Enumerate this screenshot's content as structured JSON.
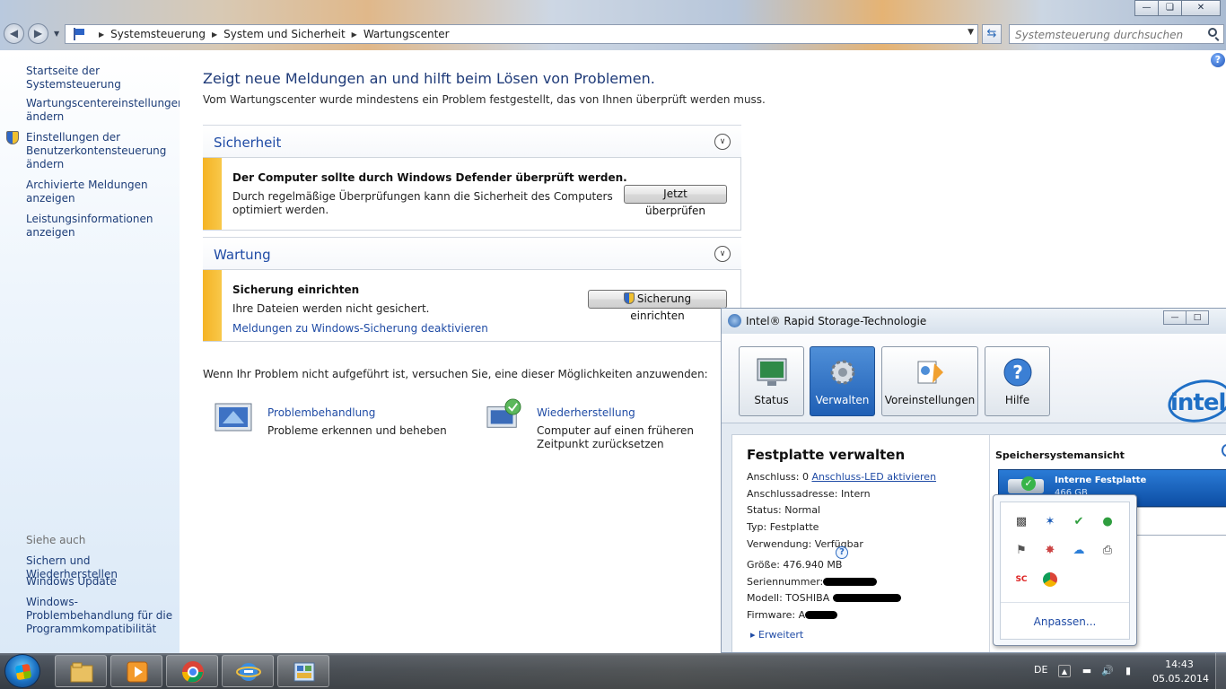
{
  "explorer": {
    "breadcrumb": [
      "Systemsteuerung",
      "System und Sicherheit",
      "Wartungscenter"
    ],
    "search_placeholder": "Systemsteuerung durchsuchen"
  },
  "sidebar": {
    "links": [
      "Startseite der Systemsteuerung",
      "Wartungscentereinstellungen ändern",
      "Einstellungen der Benutzerkontensteuerung ändern",
      "Archivierte Meldungen anzeigen",
      "Leistungsinformationen anzeigen"
    ],
    "see_also_label": "Siehe auch",
    "see_also": [
      "Sichern und Wiederherstellen",
      "Windows Update",
      "Windows-Problembehandlung für die Programmkompatibilität"
    ]
  },
  "main": {
    "title": "Zeigt neue Meldungen an und hilft beim Lösen von Problemen.",
    "subtitle": "Vom Wartungscenter wurde mindestens ein Problem festgestellt, das von Ihnen überprüft werden muss.",
    "security": {
      "heading": "Sicherheit",
      "msg_title": "Der Computer sollte durch Windows Defender überprüft werden.",
      "msg_text": "Durch regelmäßige Überprüfungen kann die Sicherheit des Computers optimiert werden.",
      "button": "Jetzt überprüfen"
    },
    "maintenance": {
      "heading": "Wartung",
      "msg_title": "Sicherung einrichten",
      "msg_text": "Ihre Dateien werden nicht gesichert.",
      "link": "Meldungen zu Windows-Sicherung deaktivieren",
      "button": "Sicherung einrichten"
    },
    "hint": "Wenn Ihr Problem nicht aufgeführt ist, versuchen Sie, eine dieser Möglichkeiten anzuwenden:",
    "tools": [
      {
        "title": "Problembehandlung",
        "desc": "Probleme erkennen und beheben"
      },
      {
        "title": "Wiederherstellung",
        "desc": "Computer auf einen früheren Zeitpunkt zurücksetzen"
      }
    ]
  },
  "rst": {
    "title": "Intel® Rapid Storage-Technologie",
    "toolbar": [
      "Status",
      "Verwalten",
      "Voreinstellungen",
      "Hilfe"
    ],
    "logo_text": "intel",
    "heading": "Festplatte verwalten",
    "props": {
      "port_label": "Anschluss: 0",
      "port_link": "Anschluss-LED aktivieren",
      "address": "Anschlussadresse: Intern",
      "status": "Status: Normal",
      "type": "Typ: Festplatte",
      "usage": "Verwendung: Verfügbar",
      "size": "Größe: 476.940 MB",
      "serial_label": "Seriennummer:",
      "model_label": "Modell: TOSHIBA",
      "firmware_label": "Firmware: A"
    },
    "advanced": "Erweitert",
    "storage_view_title": "Speichersystemansicht",
    "disk_label": "Interne Festplatte",
    "disk_size": "466 GB"
  },
  "tray": {
    "customize": "Anpassen..."
  },
  "taskbar": {
    "language": "DE",
    "time": "14:43",
    "date": "05.05.2014"
  }
}
